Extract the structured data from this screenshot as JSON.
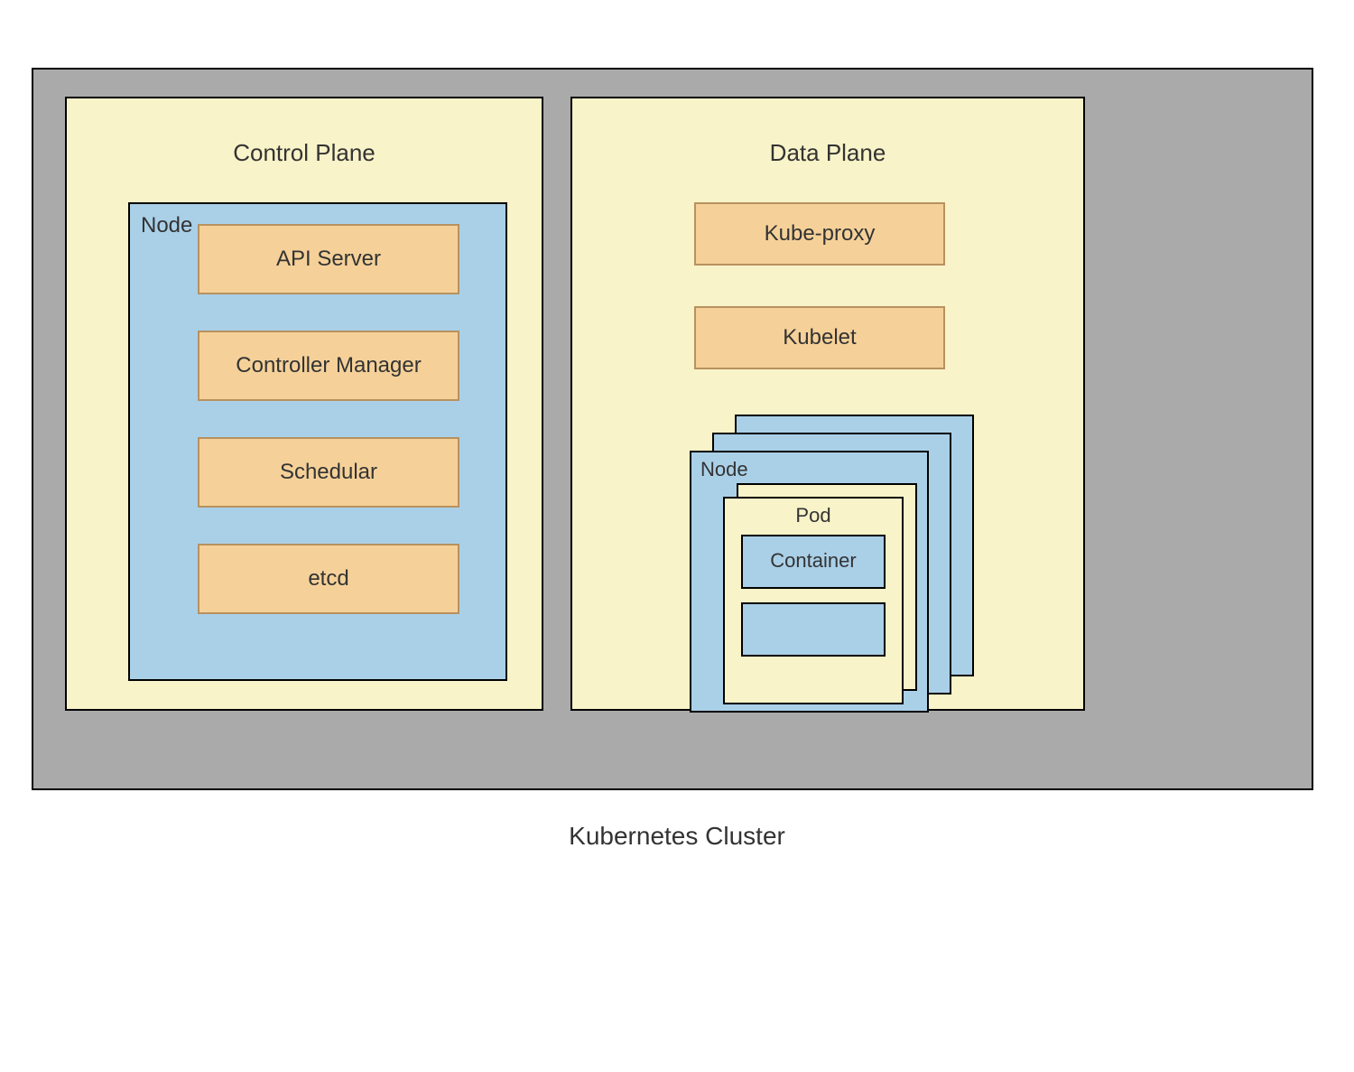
{
  "caption": "Kubernetes Cluster",
  "control_plane": {
    "title": "Control Plane",
    "node_label": "Node",
    "components": [
      "API Server",
      "Controller Manager",
      "Schedular",
      "etcd"
    ]
  },
  "data_plane": {
    "title": "Data Plane",
    "components": [
      "Kube-proxy",
      "Kubelet"
    ],
    "node_label": "Node",
    "pod_label": "Pod",
    "container_label": "Container"
  },
  "colors": {
    "frame_bg": "#aaaaaa",
    "plane_bg": "#f8f3c8",
    "node_bg": "#aad0e8",
    "component_bg": "#f5d199",
    "component_border": "#b8915f",
    "border": "#000000"
  }
}
